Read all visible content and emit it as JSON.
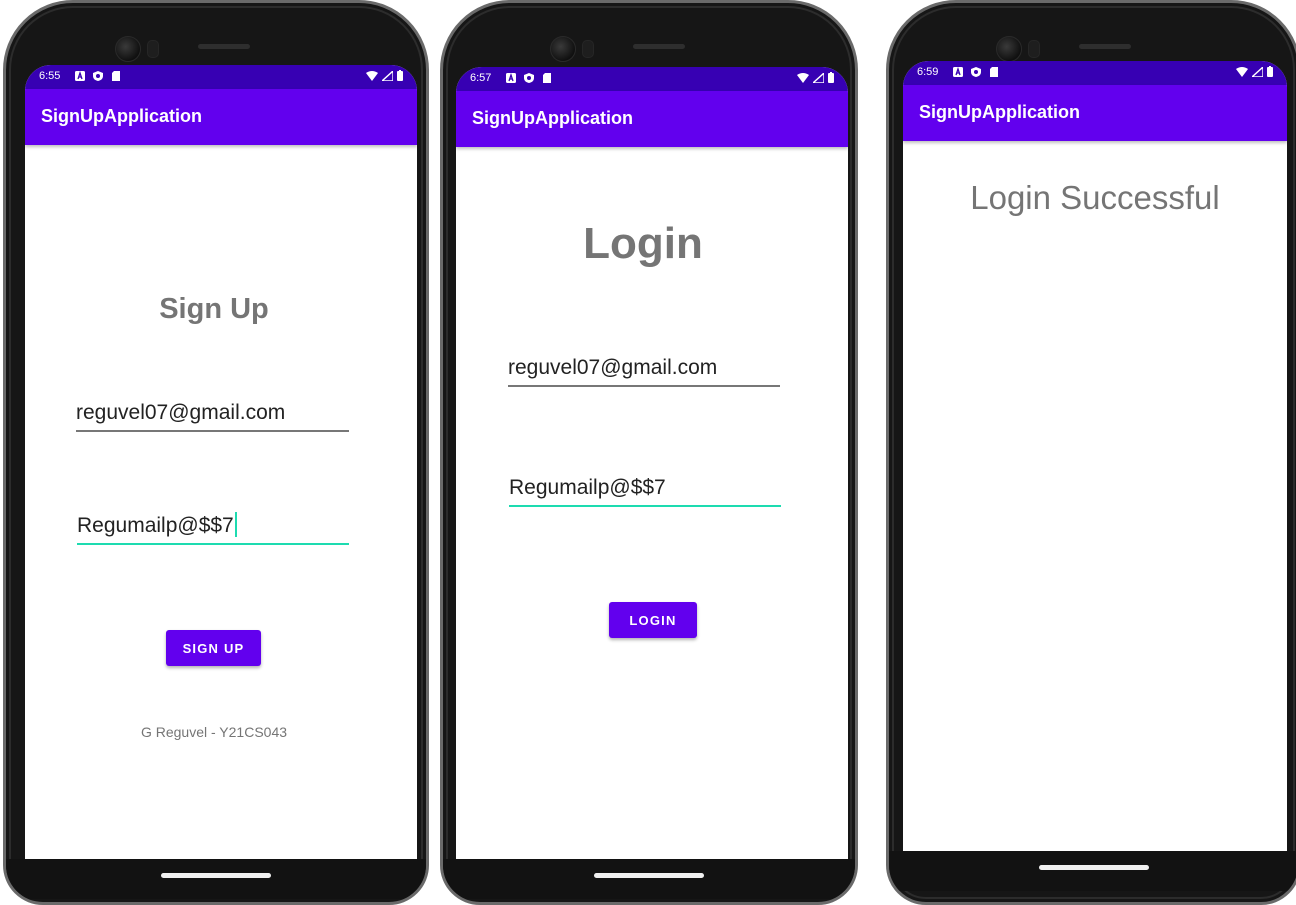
{
  "colors": {
    "status_bar": "#3700b3",
    "app_bar": "#6200ee",
    "button": "#6200ee",
    "focus_underline": "#1ddbb0",
    "heading_text": "#757575"
  },
  "screens": [
    {
      "status_time": "6:55",
      "status_icons": [
        "a-notification-icon",
        "shield-icon",
        "sd-card-icon"
      ],
      "status_right_icons": [
        "wifi-icon",
        "signal-icon",
        "battery-icon"
      ],
      "app_title": "SignUpApplication",
      "heading": "Sign Up",
      "email_value": "reguvel07@gmail.com",
      "password_value": "Regumailp@$$7",
      "button_label": "SIGN UP",
      "footer_text": "G Reguvel - Y21CS043"
    },
    {
      "status_time": "6:57",
      "status_icons": [
        "a-notification-icon",
        "shield-icon",
        "sd-card-icon"
      ],
      "status_right_icons": [
        "wifi-icon",
        "signal-icon",
        "battery-icon"
      ],
      "app_title": "SignUpApplication",
      "heading": "Login",
      "email_value": "reguvel07@gmail.com",
      "password_value": "Regumailp@$$7",
      "button_label": "LOGIN"
    },
    {
      "status_time": "6:59",
      "status_icons": [
        "a-notification-icon",
        "shield-icon",
        "sd-card-icon"
      ],
      "status_right_icons": [
        "wifi-icon",
        "signal-icon",
        "battery-icon"
      ],
      "app_title": "SignUpApplication",
      "message": "Login Successful"
    }
  ]
}
